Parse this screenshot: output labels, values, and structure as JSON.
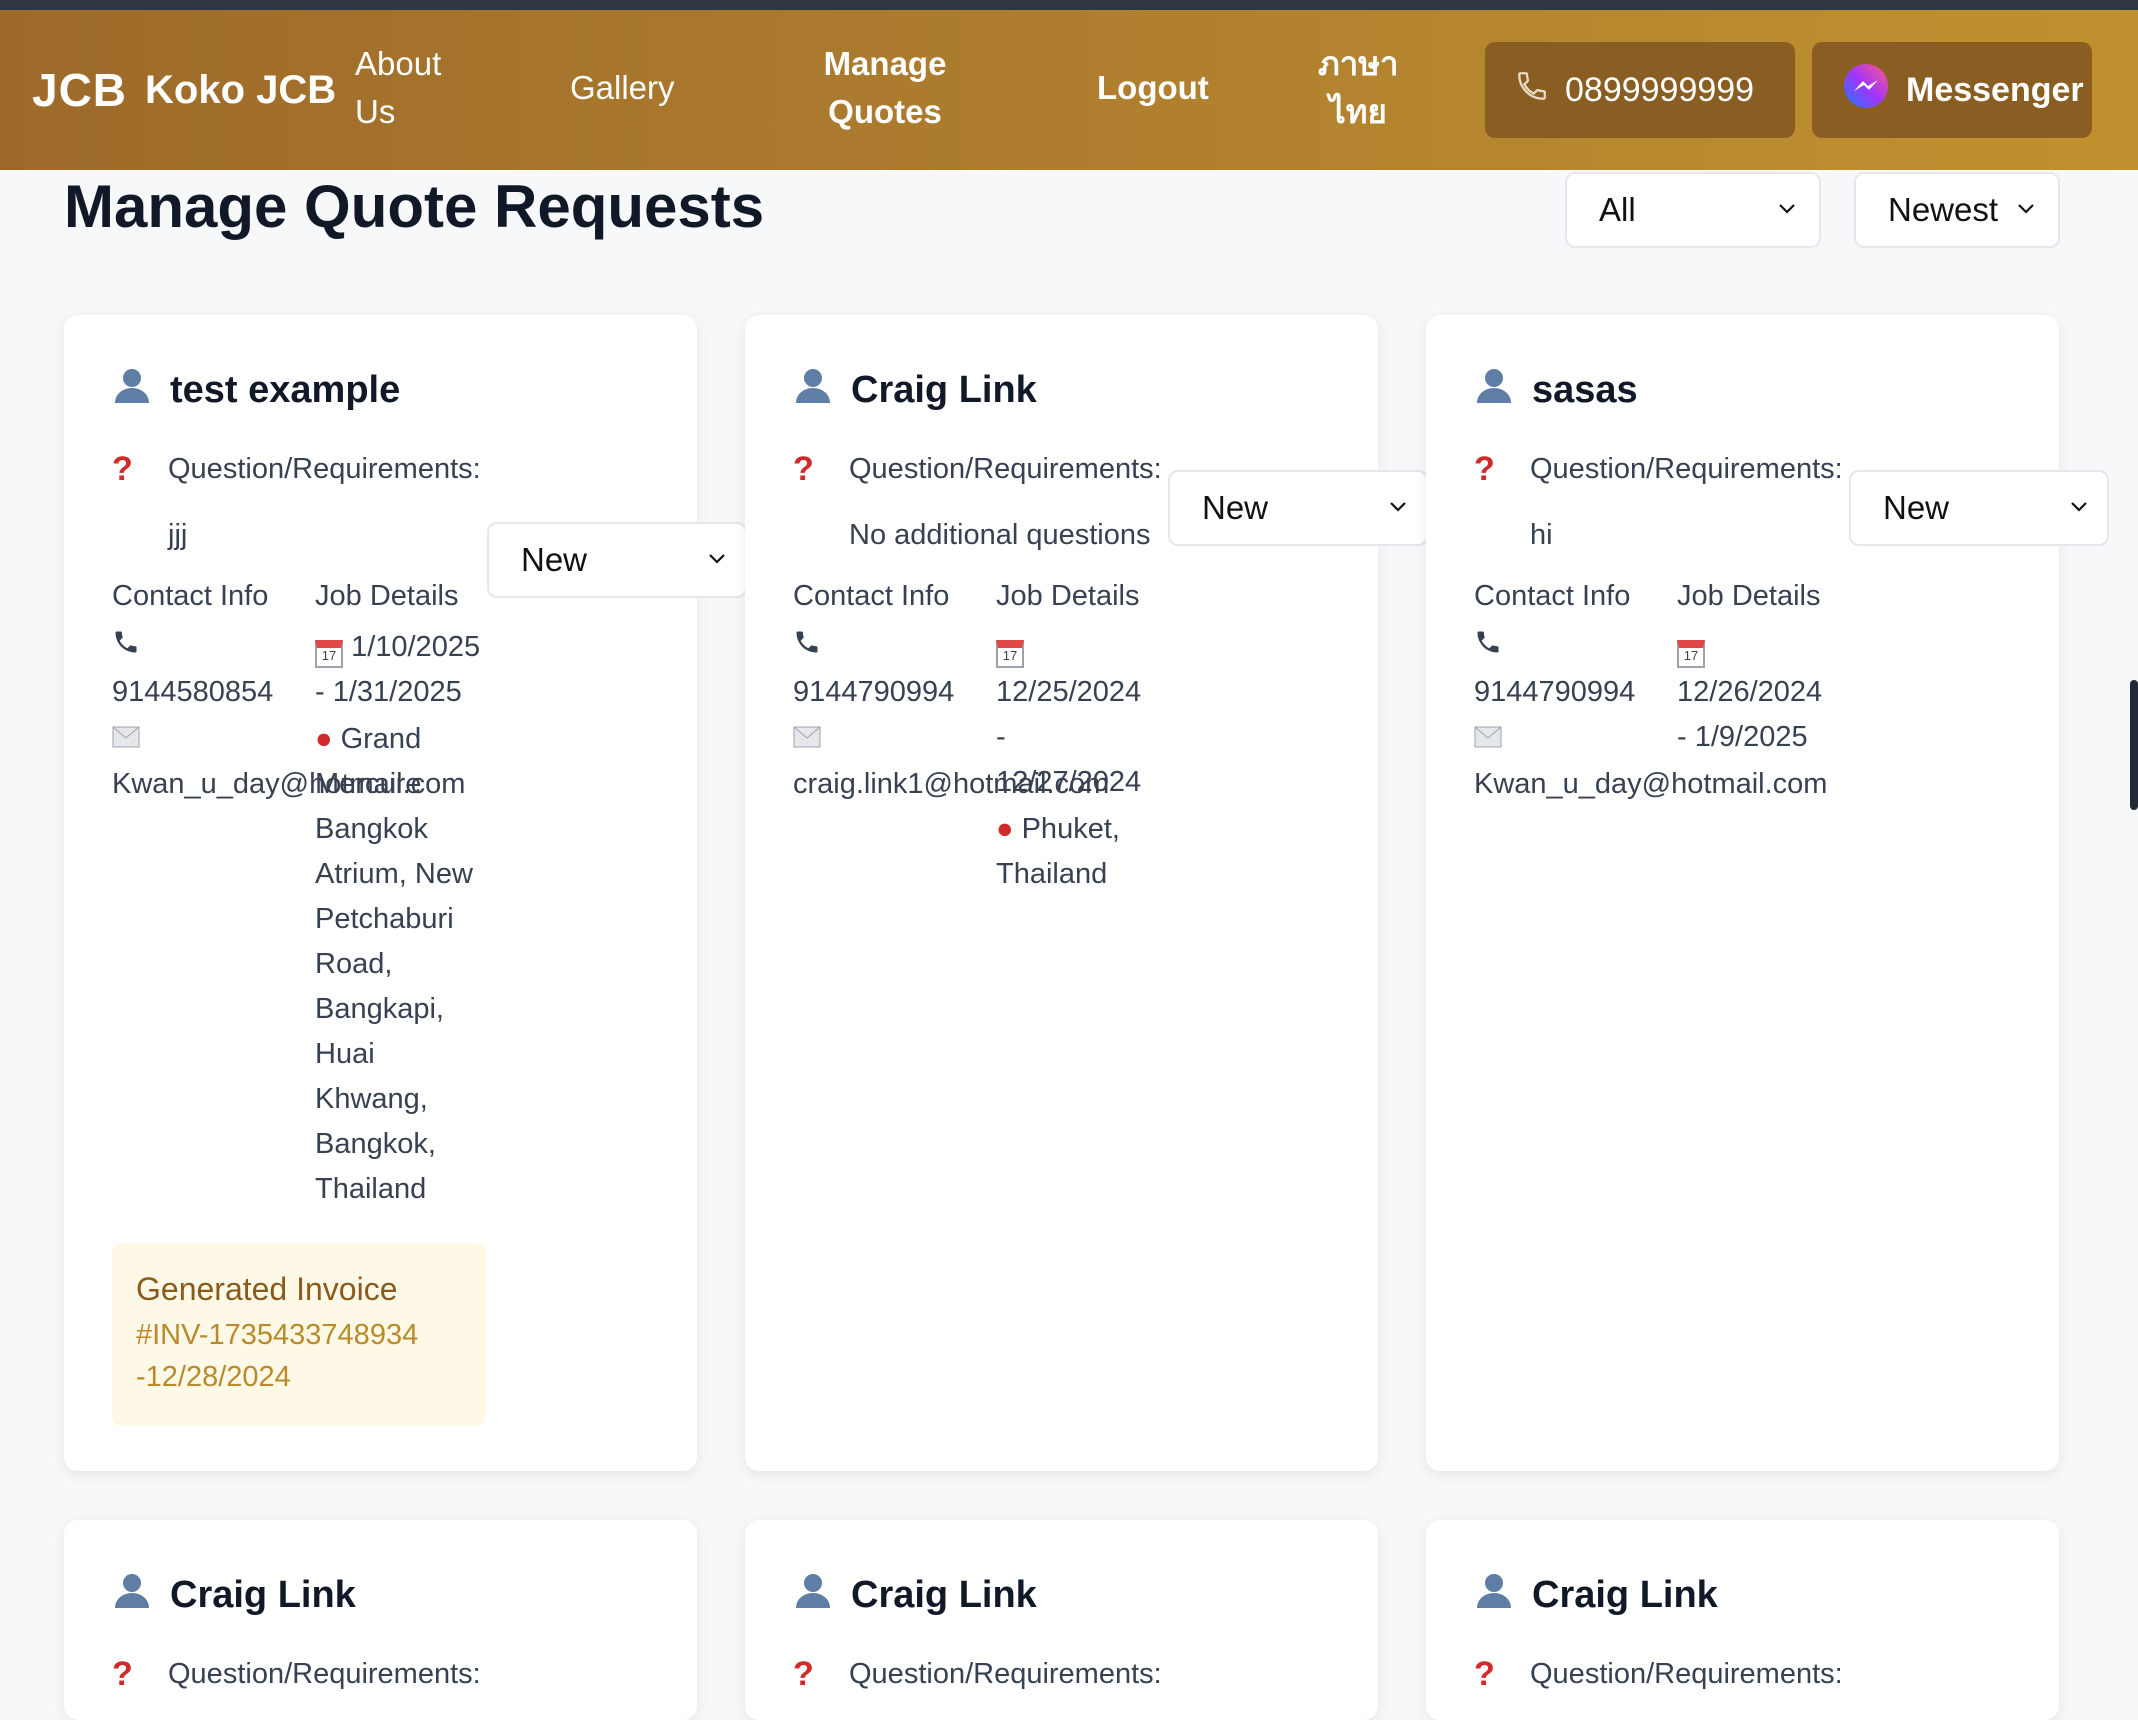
{
  "nav": {
    "logo": "JCB",
    "brand": "Koko JCB",
    "about_line1": "About",
    "about_line2": "Us",
    "gallery": "Gallery",
    "manage_line1": "Manage",
    "manage_line2": "Quotes",
    "logout": "Logout",
    "thai_line1": "ภาษา",
    "thai_line2": "ไทย",
    "phone": "0899999999",
    "messenger": "Messenger"
  },
  "page": {
    "title": "Manage Quote Requests",
    "filter_value": "All",
    "sort_value": "Newest"
  },
  "labels": {
    "question": "Question/Requirements:",
    "contact": "Contact Info",
    "job": "Job Details",
    "status_value": "New"
  },
  "cards": [
    {
      "name": "test example",
      "answer": "jjj",
      "phone": "9144580854",
      "email": "Kwan_u_day@hotmail.com",
      "date_line1": "1/10/2025",
      "date_line2": "- 1/31/2025",
      "loc_line1": "Grand",
      "loc_line2": "Mercure",
      "loc_rest": [
        "Bangkok",
        "Atrium, New",
        "Petchaburi",
        "Road,",
        "Bangkapi,",
        "Huai",
        "Khwang,",
        "Bangkok,",
        "Thailand"
      ],
      "invoice_title": "Generated Invoice",
      "invoice_num": "#INV-1735433748934",
      "invoice_date": "-12/28/2024"
    },
    {
      "name": "Craig Link",
      "answer": "No additional questions",
      "phone": "9144790994",
      "email": "craig.link1@hotmail.com",
      "date_line1": "12/25/2024",
      "date_line2": "-",
      "date_line3": "12/27/2024",
      "loc_line1": "Phuket,",
      "loc_line2": "Thailand"
    },
    {
      "name": "sasas",
      "answer": "hi",
      "phone": "9144790994",
      "email": "Kwan_u_day@hotmail.com",
      "date_line1": "12/26/2024",
      "date_line2": "- 1/9/2025"
    },
    {
      "name": "Craig Link"
    },
    {
      "name": "Craig Link"
    },
    {
      "name": "Craig Link"
    }
  ]
}
